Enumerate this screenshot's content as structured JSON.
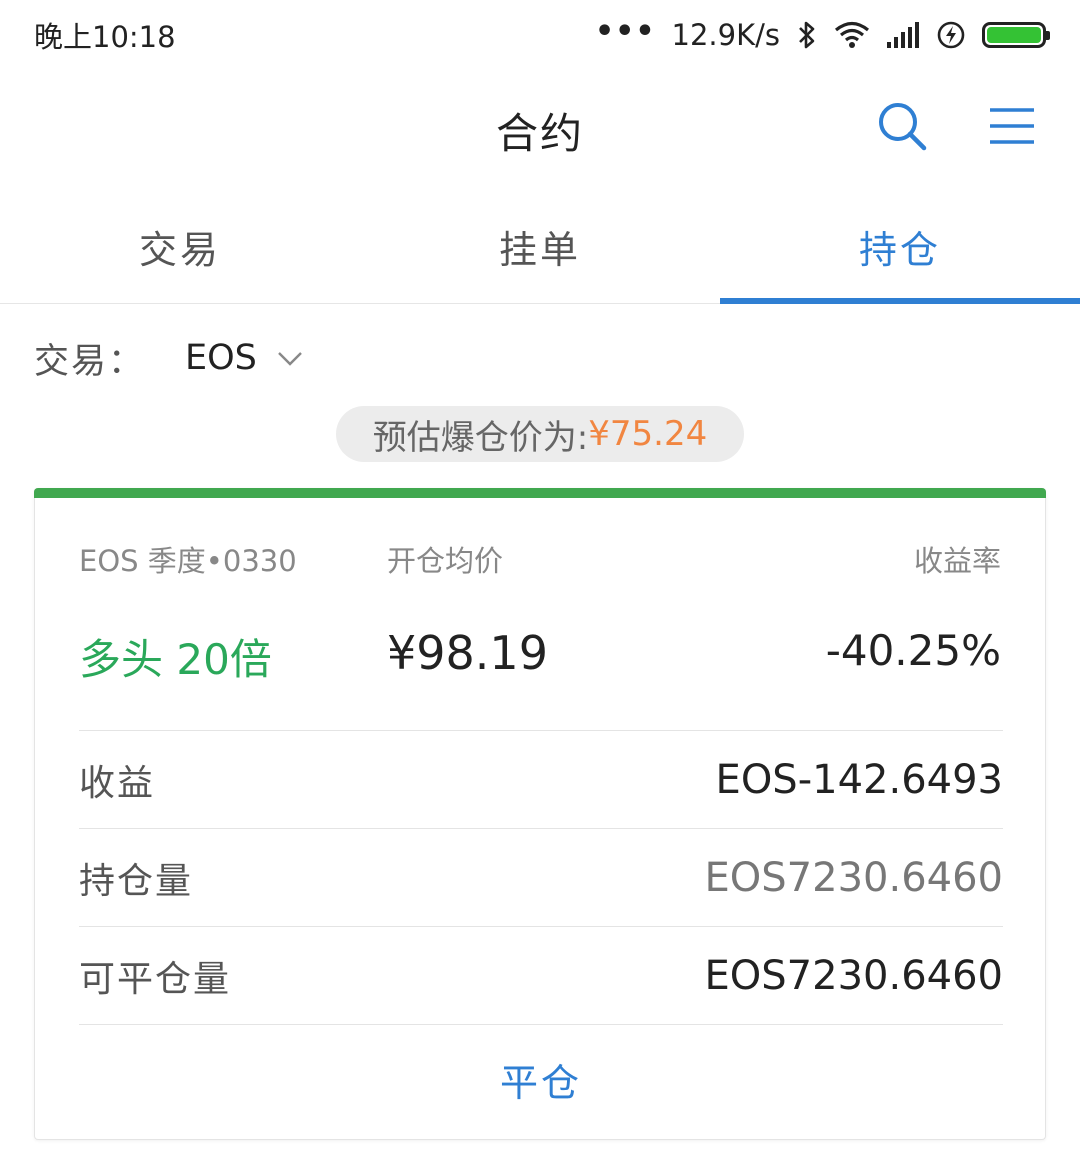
{
  "status_bar": {
    "time": "晚上10:18",
    "dots": "•••",
    "speed": "12.9K/s",
    "icons": [
      "bluetooth-icon",
      "wifi-icon",
      "signal-icon",
      "charging-icon",
      "battery-icon"
    ]
  },
  "header": {
    "title": "合约",
    "search_icon": "search-icon",
    "menu_icon": "menu-icon"
  },
  "tabs": [
    {
      "label": "交易",
      "active": false
    },
    {
      "label": "挂单",
      "active": false
    },
    {
      "label": "持仓",
      "active": true
    }
  ],
  "pair": {
    "label": "交易：",
    "value": "EOS"
  },
  "liquidation": {
    "label": "预估爆仓价为:",
    "price": "¥75.24"
  },
  "position": {
    "contract": "EOS 季度•0330",
    "avg_price_label": "开仓均价",
    "yield_label": "收益率",
    "direction": "多头 20倍",
    "avg_price": "¥98.19",
    "yield": "-40.25%",
    "details": [
      {
        "label": "收益",
        "value": "EOS-142.6493"
      },
      {
        "label": "持仓量",
        "value": "EOS7230.6460"
      },
      {
        "label": "可平仓量",
        "value": "EOS7230.6460"
      }
    ],
    "close_label": "平仓"
  },
  "colors": {
    "accent": "#2f7fd3",
    "long_green": "#2aa85a",
    "card_bar": "#41a84f",
    "liq_orange": "#f18641"
  }
}
